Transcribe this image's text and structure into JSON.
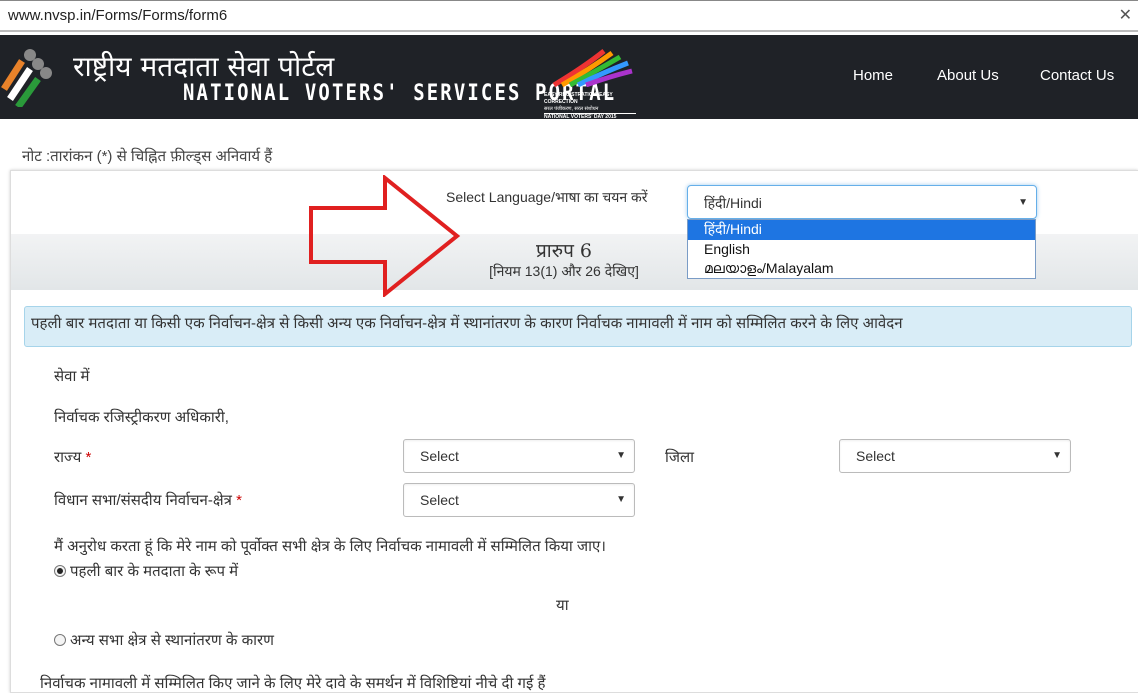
{
  "browser": {
    "url": "www.nvsp.in/Forms/Forms/form6",
    "close_glyph": "✕"
  },
  "header": {
    "title_hindi": "राष्ट्रीय मतदाता सेवा पोर्टल",
    "title_english": "NATIONAL VOTERS' SERVICES PORTAL",
    "badge_lines": [
      "EASY REGISTRATION, EASY CORRECTION",
      "सरल पंजीकरण, सरल संशोधन",
      "NATIONAL VOTERS' DAY 2015"
    ],
    "nav": [
      "Home",
      "About Us",
      "Contact Us"
    ]
  },
  "note": "नोट :तारांकन (*) से चिह्नित फ़ील्ड्स अनिवार्य हैं",
  "language": {
    "label": "Select Language/भाषा का चयन करें",
    "selected": "हिंदी/Hindi",
    "options": [
      "हिंदी/Hindi",
      "English",
      "മലയാളം/Malayalam"
    ],
    "highlighted_index": 0
  },
  "form": {
    "title": "प्रारुप 6",
    "subtitle": "[नियम 13(1) और 26 देखिए]",
    "info": "पहली बार मतदाता या किसी एक निर्वाचन-क्षेत्र से किसी अन्य एक निर्वाचन-क्षेत्र में स्थानांतरण के कारण निर्वाचक नामावली में नाम को सम्मिलित करने के लिए आवेदन",
    "to": "सेवा में",
    "officer": "निर्वाचक रजिस्ट्रीकरण अधिकारी,",
    "state_label": "राज्य",
    "district_label": "जिला",
    "constituency_label": "विधान सभा/संसदीय निर्वाचन-क्षेत्र",
    "required": "*",
    "state_value": "Select",
    "district_value": "Select",
    "constituency_value": "Select",
    "request": "मैं अनुरोध करता हूं कि मेरे नाम को पूर्वोक्त सभी क्षेत्र के लिए निर्वाचक नामावली में सम्मिलित किया जाए।",
    "radio_first": "पहली बार के मतदाता के रूप में",
    "or": "या",
    "radio_shift": "अन्य सभा क्षेत्र से स्थानांतरण के कारण",
    "radio_first_checked": true,
    "particulars": "निर्वाचक नामावली में सम्मिलित किए जाने के लिए मेरे दावे के समर्थन में विशिष्टियां नीचे दी गई हैं"
  },
  "annotation": {
    "arrow_color": "#e02020"
  }
}
